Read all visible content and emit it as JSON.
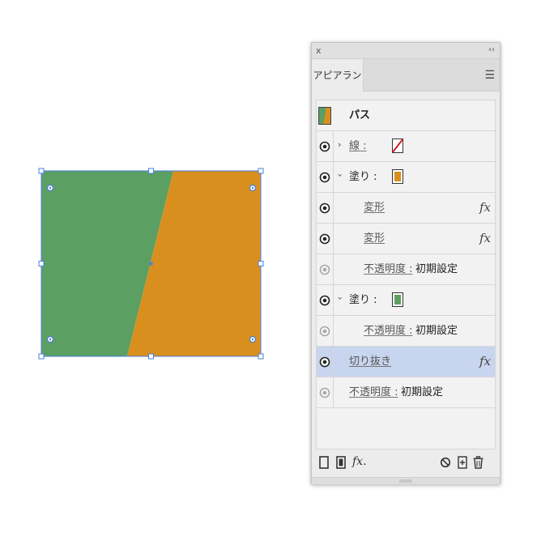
{
  "panel": {
    "title": "アピアランス",
    "close_glyph": "x",
    "collapse_glyph": "‹‹",
    "menu_glyph": "☰",
    "object_label": "パス"
  },
  "rows": [
    {
      "id": "stroke",
      "label": "線 :",
      "swatch": "none",
      "expanded": false
    },
    {
      "id": "fill1",
      "label": "塗り :",
      "swatch": "#d88f1e",
      "expanded": true
    },
    {
      "id": "transform1",
      "label": "変形",
      "effect": true
    },
    {
      "id": "transform2",
      "label": "変形",
      "effect": true
    },
    {
      "id": "opacity1",
      "label": "不透明度 :",
      "value": "初期設定"
    },
    {
      "id": "fill2",
      "label": "塗り :",
      "swatch": "#5b9f63",
      "expanded": true
    },
    {
      "id": "opacity2",
      "label": "不透明度 :",
      "value": "初期設定"
    },
    {
      "id": "clip",
      "label": "切り抜き",
      "effect": true,
      "selected": true
    },
    {
      "id": "opacity3",
      "label": "不透明度 :",
      "value": "初期設定"
    }
  ],
  "fx_glyph": "fx",
  "bottom": {
    "fx_label": "fx."
  },
  "colors": {
    "green": "#5b9f63",
    "orange": "#d88f1e",
    "selection_blue": "#4a7fe0",
    "selected_row": "#c8d5ee"
  }
}
